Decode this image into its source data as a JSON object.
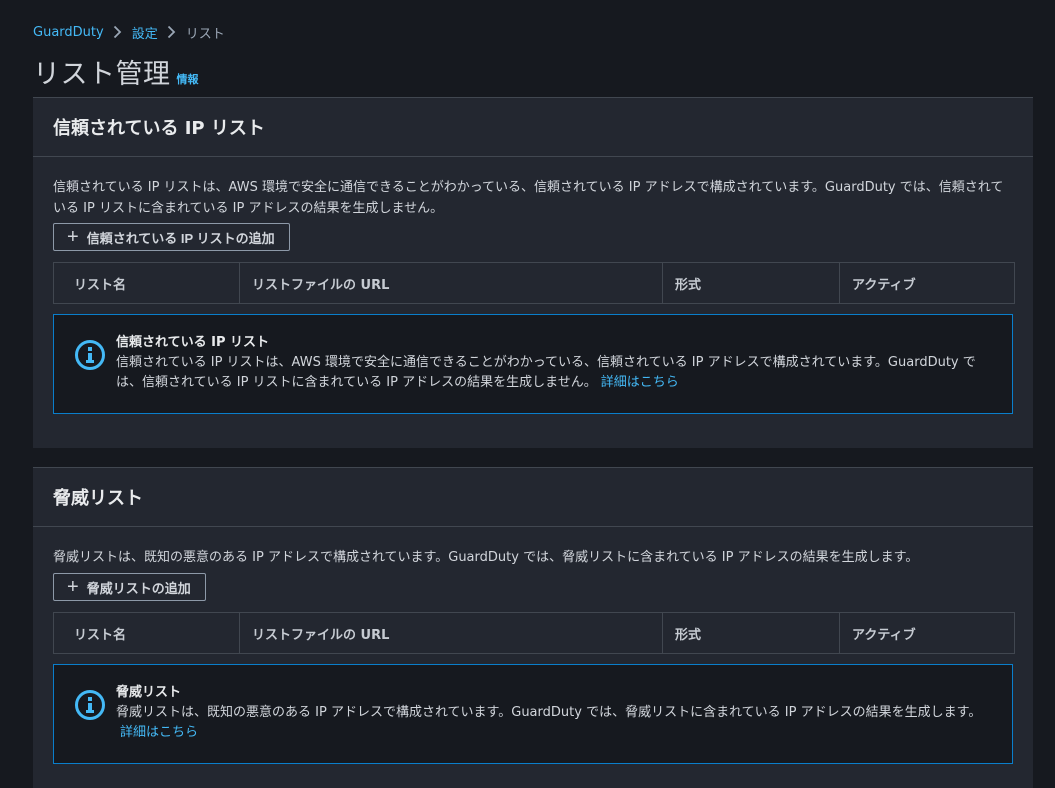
{
  "breadcrumb": [
    {
      "label": "GuardDuty"
    },
    {
      "label": "設定"
    },
    {
      "label": "リスト"
    }
  ],
  "page": {
    "title": "リスト管理",
    "info": "情報"
  },
  "trusted": {
    "title": "信頼されている IP リスト",
    "description": "信頼されている IP リストは、AWS 環境で安全に通信できることがわかっている、信頼されている IP アドレスで構成されています。GuardDuty では、信頼されている IP リストに含まれている IP アドレスの結果を生成しません。",
    "add_label": "信頼されている IP リストの追加",
    "columns": [
      "リスト名",
      "リストファイルの URL",
      "形式",
      "アクティブ"
    ],
    "alert": {
      "title": "信頼されている IP リスト",
      "text": "信頼されている IP リストは、AWS 環境で安全に通信できることがわかっている、信頼されている IP アドレスで構成されています。GuardDuty では、信頼されている IP リストに含まれている IP アドレスの結果を生成しません。",
      "link": "詳細はこちら"
    }
  },
  "threat": {
    "title": "脅威リスト",
    "description": "脅威リストは、既知の悪意のある IP アドレスで構成されています。GuardDuty では、脅威リストに含まれている IP アドレスの結果を生成します。",
    "add_label": "脅威リストの追加",
    "columns": [
      "リスト名",
      "リストファイルの URL",
      "形式",
      "アクティブ"
    ],
    "alert": {
      "title": "脅威リスト",
      "text": "脅威リストは、既知の悪意のある IP アドレスで構成されています。GuardDuty では、脅威リストに含まれている IP アドレスの結果を生成します。",
      "link": "詳細はこちら"
    }
  },
  "icons": {
    "breadcrumb_separator": "chevron-right-icon",
    "add": "plus-icon",
    "alert": "info-circle-icon"
  },
  "colors": {
    "background": "#16191f",
    "container": "#232730",
    "link": "#44b9f6",
    "info_border": "#0a7ecb"
  }
}
